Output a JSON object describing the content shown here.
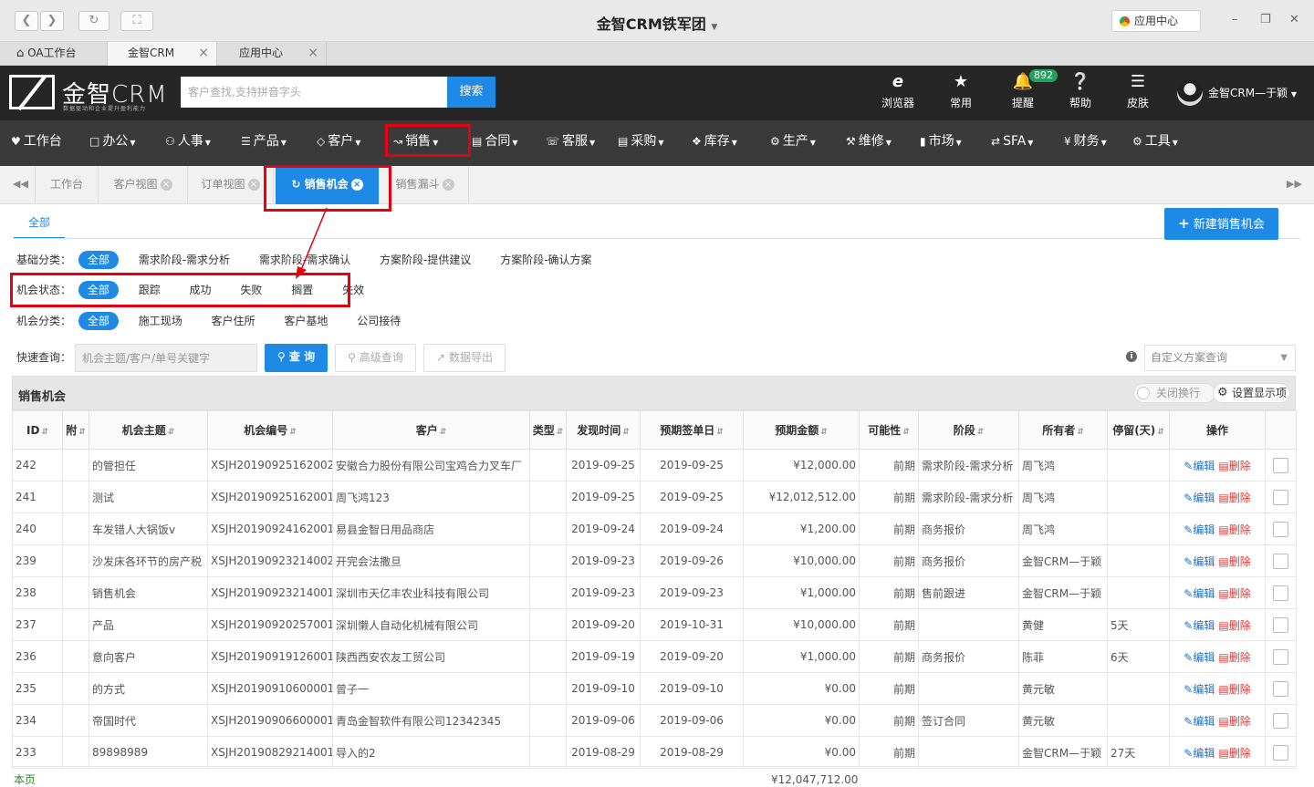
{
  "window": {
    "title": "金智CRM铁军团",
    "app_center": "应用中心"
  },
  "browser_tabs": [
    {
      "label": "OA工作台"
    },
    {
      "label": "金智CRM"
    },
    {
      "label": "应用中心"
    }
  ],
  "header": {
    "logo_text": "金智CRM",
    "logo_slogan": "数据驱动和企业提升盈利能力",
    "search_placeholder": "客户查找,支持拼音字头",
    "search_button": "搜索",
    "icons": [
      {
        "label": "浏览器",
        "icon": "ie-icon"
      },
      {
        "label": "常用",
        "icon": "star-icon"
      },
      {
        "label": "提醒",
        "icon": "bell-icon",
        "badge": "892"
      },
      {
        "label": "帮助",
        "icon": "help-icon"
      },
      {
        "label": "皮肤",
        "icon": "skin-icon"
      }
    ],
    "user": "金智CRM—于颖"
  },
  "menu": [
    {
      "label": "工作台"
    },
    {
      "label": "办公"
    },
    {
      "label": "人事"
    },
    {
      "label": "产品"
    },
    {
      "label": "客户"
    },
    {
      "label": "销售"
    },
    {
      "label": "合同"
    },
    {
      "label": "客服"
    },
    {
      "label": "采购"
    },
    {
      "label": "库存"
    },
    {
      "label": "生产"
    },
    {
      "label": "维修"
    },
    {
      "label": "市场"
    },
    {
      "label": "SFA"
    },
    {
      "label": "财务"
    },
    {
      "label": "工具"
    }
  ],
  "page_tabs": [
    {
      "label": "工作台"
    },
    {
      "label": "客户视图"
    },
    {
      "label": "订单视图"
    },
    {
      "label": "销售机会"
    },
    {
      "label": "销售漏斗"
    }
  ],
  "subtab": "全部",
  "new_button": "新建销售机会",
  "filters": {
    "basic": {
      "label": "基础分类：",
      "options": [
        "全部",
        "需求阶段-需求分析",
        "需求阶段-需求确认",
        "方案阶段-提供建议",
        "方案阶段-确认方案"
      ]
    },
    "status": {
      "label": "机会状态：",
      "options": [
        "全部",
        "跟踪",
        "成功",
        "失败",
        "搁置",
        "失效"
      ]
    },
    "category": {
      "label": "机会分类：",
      "options": [
        "全部",
        "施工现场",
        "客户住所",
        "客户基地",
        "公司接待"
      ]
    }
  },
  "quick": {
    "label": "快速查询：",
    "placeholder": "机会主题/客户/单号关键字",
    "query": "查 询",
    "advanced": "高级查询",
    "export": "数据导出",
    "custom_placeholder": "自定义方案查询"
  },
  "grid": {
    "title": "销售机会",
    "toggle": "关闭换行",
    "settings": "设置显示项",
    "columns": [
      "ID",
      "附",
      "机会主题",
      "机会编号",
      "客户",
      "类型",
      "发现时间",
      "预期签单日",
      "预期金额",
      "可能性",
      "阶段",
      "所有者",
      "停留(天)",
      "操作"
    ],
    "edit": "编辑",
    "delete": "删除",
    "rows": [
      {
        "id": "242",
        "topic": "的管担任",
        "no": "XSJH20190925162002",
        "customer": "安徽合力股份有限公司宝鸡合力叉车厂",
        "type": "",
        "found": "2019-09-25",
        "sign": "2019-09-25",
        "amount": "¥12,000.00",
        "prob": "前期",
        "stage": "需求阶段-需求分析",
        "owner": "周飞鸿",
        "stay": ""
      },
      {
        "id": "241",
        "topic": "测试",
        "no": "XSJH20190925162001",
        "customer": "周飞鸿123",
        "type": "",
        "found": "2019-09-25",
        "sign": "2019-09-25",
        "amount": "¥12,012,512.00",
        "prob": "前期",
        "stage": "需求阶段-需求分析",
        "owner": "周飞鸿",
        "stay": ""
      },
      {
        "id": "240",
        "topic": "车发错人大锅饭v",
        "no": "XSJH20190924162001",
        "customer": "易县金智日用品商店",
        "type": "",
        "found": "2019-09-24",
        "sign": "2019-09-24",
        "amount": "¥1,200.00",
        "prob": "前期",
        "stage": "商务报价",
        "owner": "周飞鸿",
        "stay": ""
      },
      {
        "id": "239",
        "topic": "沙发床各环节的房产税",
        "no": "XSJH20190923214002",
        "customer": "开完会法撒旦",
        "type": "",
        "found": "2019-09-23",
        "sign": "2019-09-26",
        "amount": "¥10,000.00",
        "prob": "前期",
        "stage": "商务报价",
        "owner": "金智CRM—于颖",
        "stay": ""
      },
      {
        "id": "238",
        "topic": "销售机会",
        "no": "XSJH20190923214001",
        "customer": "深圳市天亿丰农业科技有限公司",
        "type": "",
        "found": "2019-09-23",
        "sign": "2019-09-23",
        "amount": "¥1,000.00",
        "prob": "前期",
        "stage": "售前跟进",
        "owner": "金智CRM—于颖",
        "stay": ""
      },
      {
        "id": "237",
        "topic": "产品",
        "no": "XSJH20190920257001",
        "customer": "深圳懒人自动化机械有限公司",
        "type": "",
        "found": "2019-09-20",
        "sign": "2019-10-31",
        "amount": "¥10,000.00",
        "prob": "前期",
        "stage": "",
        "owner": "黄健",
        "stay": "5天"
      },
      {
        "id": "236",
        "topic": "意向客户",
        "no": "XSJH20190919126001",
        "customer": "陕西西安农友工贸公司",
        "type": "",
        "found": "2019-09-19",
        "sign": "2019-09-20",
        "amount": "¥1,000.00",
        "prob": "前期",
        "stage": "商务报价",
        "owner": "陈菲",
        "stay": "6天"
      },
      {
        "id": "235",
        "topic": "的方式",
        "no": "XSJH20190910600001",
        "customer": "曾子一",
        "type": "",
        "found": "2019-09-10",
        "sign": "2019-09-10",
        "amount": "¥0.00",
        "prob": "前期",
        "stage": "",
        "owner": "黄元敏",
        "stay": ""
      },
      {
        "id": "234",
        "topic": "帝国时代",
        "no": "XSJH20190906600001",
        "customer": "青岛金智软件有限公司12342345",
        "type": "",
        "found": "2019-09-06",
        "sign": "2019-09-06",
        "amount": "¥0.00",
        "prob": "前期",
        "stage": "签订合同",
        "owner": "黄元敏",
        "stay": ""
      },
      {
        "id": "233",
        "topic": "89898989",
        "no": "XSJH20190829214001",
        "customer": "导入的2",
        "type": "",
        "found": "2019-08-29",
        "sign": "2019-08-29",
        "amount": "¥0.00",
        "prob": "前期",
        "stage": "",
        "owner": "金智CRM—于颖",
        "stay": "27天"
      }
    ],
    "summary_label": "本页",
    "summary_total": "¥12,047,712.00"
  }
}
